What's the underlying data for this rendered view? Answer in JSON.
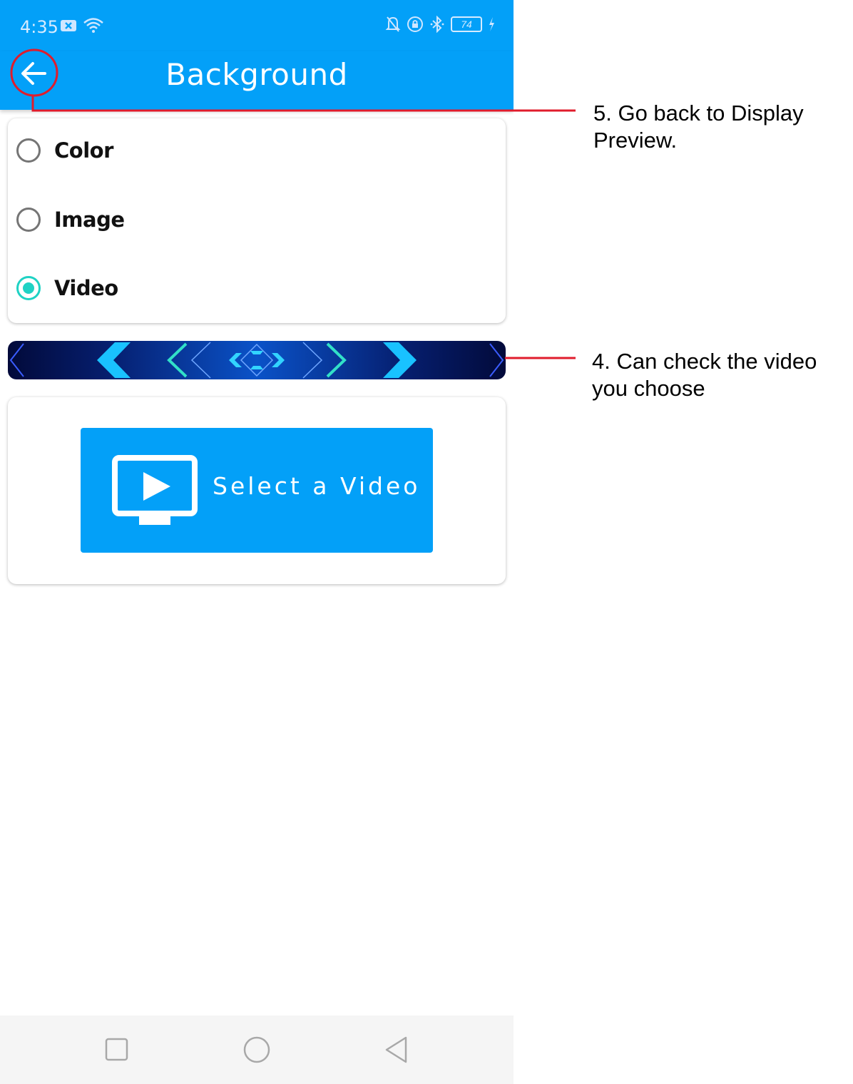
{
  "status_bar": {
    "time": "4:35",
    "battery_level": "74",
    "icons": [
      "notification-x-icon",
      "wifi-icon",
      "mute-bell-icon",
      "lock-rotation-icon",
      "bluetooth-icon",
      "battery-icon",
      "charging-icon"
    ]
  },
  "appbar": {
    "title": "Background",
    "back_icon": "arrow-left-icon"
  },
  "background_options": [
    {
      "label": "Color",
      "selected": false
    },
    {
      "label": "Image",
      "selected": false
    },
    {
      "label": "Video",
      "selected": true
    }
  ],
  "select_video": {
    "label": "Select a Video",
    "icon": "monitor-play-icon"
  },
  "navbar": {
    "icons": [
      "recents-square-icon",
      "home-circle-icon",
      "back-triangle-icon"
    ]
  },
  "annotations": {
    "back": {
      "line1": "5. Go back to Display",
      "line2": "Preview."
    },
    "video": {
      "line1": "4. Can check the video",
      "line2": "you choose"
    }
  },
  "colors": {
    "primary": "#03a0f8",
    "radio_selected": "#1fd2c4",
    "annotation_red": "#e01c2c"
  }
}
